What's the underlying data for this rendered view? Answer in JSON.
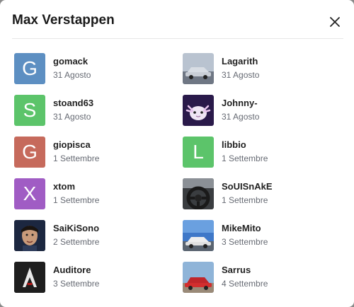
{
  "dialog": {
    "title": "Max Verstappen",
    "close_icon": "close-icon"
  },
  "left_column": [
    {
      "name": "gomack",
      "date": "31 Agosto",
      "avatar_letter": "G",
      "avatar_color": "#5d8fc2"
    },
    {
      "name": "stoand63",
      "date": "31 Agosto",
      "avatar_letter": "S",
      "avatar_color": "#5cc46a"
    },
    {
      "name": "giopisca",
      "date": "1 Settembre",
      "avatar_letter": "G",
      "avatar_color": "#c66a5c"
    },
    {
      "name": "xtom",
      "date": "1 Settembre",
      "avatar_letter": "X",
      "avatar_color": "#a05cc4"
    },
    {
      "name": "SaiKiSono",
      "date": "2 Settembre",
      "avatar_image": "portrait-photo"
    },
    {
      "name": "Auditore",
      "date": "3 Settembre",
      "avatar_image": "assassin-logo"
    }
  ],
  "right_column": [
    {
      "name": "Lagarith",
      "date": "31 Agosto",
      "avatar_image": "car-photo"
    },
    {
      "name": "Johnny-",
      "date": "31 Agosto",
      "avatar_image": "axolotl-image"
    },
    {
      "name": "libbio",
      "date": "1 Settembre",
      "avatar_letter": "L",
      "avatar_color": "#5cc46a"
    },
    {
      "name": "SoUISnAkE",
      "date": "1 Settembre",
      "avatar_image": "steering-wheel-photo"
    },
    {
      "name": "MikeMito",
      "date": "3 Settembre",
      "avatar_image": "car-photo"
    },
    {
      "name": "Sarrus",
      "date": "4 Settembre",
      "avatar_image": "red-car-photo"
    }
  ]
}
